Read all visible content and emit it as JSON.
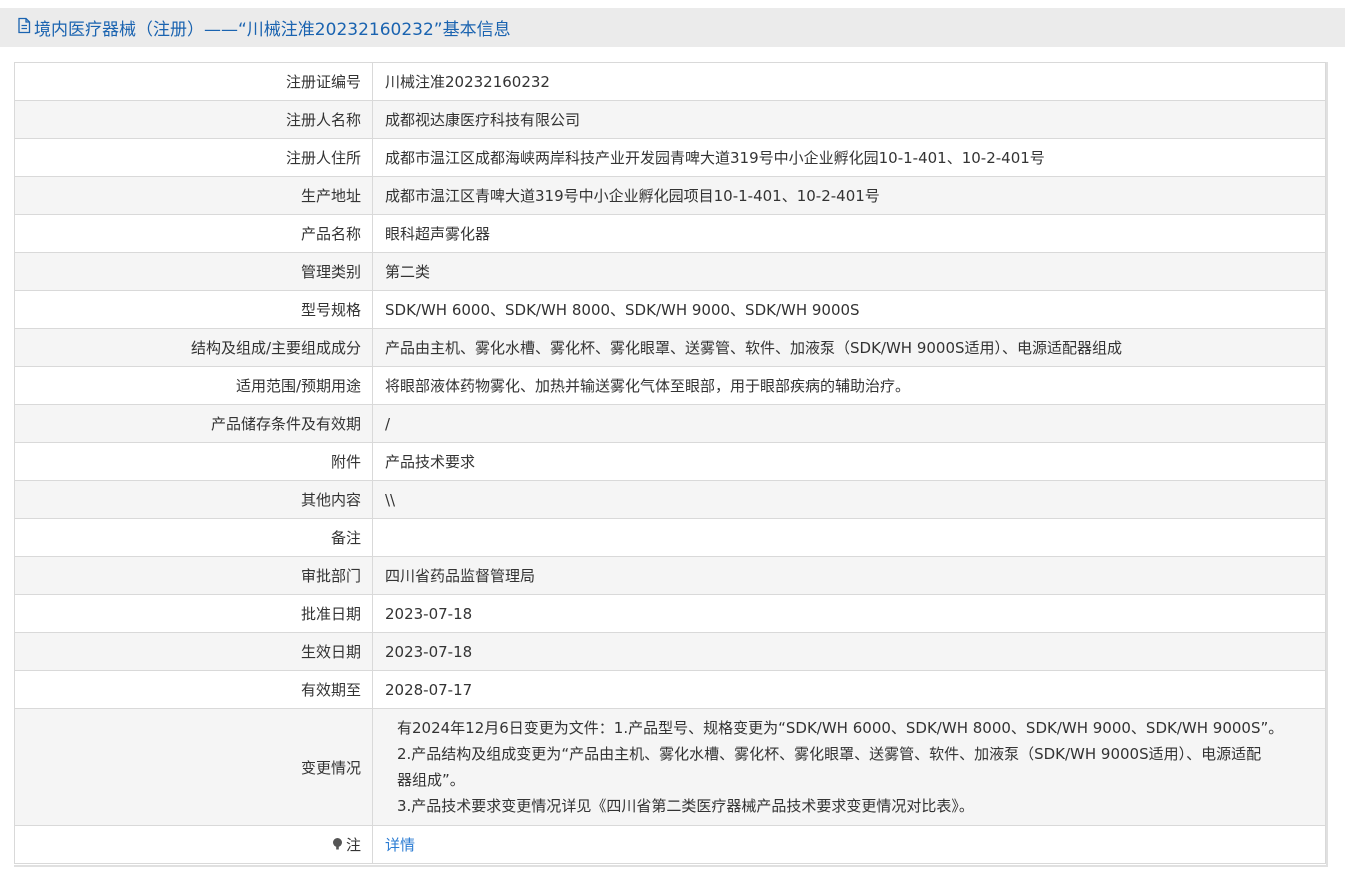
{
  "header": {
    "title": "境内医疗器械（注册）——“川械注准20232160232”基本信息",
    "icon": "document-icon",
    "color": "#1a63b0"
  },
  "rows": [
    {
      "label": "注册证编号",
      "value": "川械注准20232160232"
    },
    {
      "label": "注册人名称",
      "value": "成都视达康医疗科技有限公司"
    },
    {
      "label": "注册人住所",
      "value": "成都市温江区成都海峡两岸科技产业开发园青啤大道319号中小企业孵化园10-1-401、10-2-401号"
    },
    {
      "label": "生产地址",
      "value": "成都市温江区青啤大道319号中小企业孵化园项目10-1-401、10-2-401号"
    },
    {
      "label": "产品名称",
      "value": "眼科超声雾化器"
    },
    {
      "label": "管理类别",
      "value": "第二类"
    },
    {
      "label": "型号规格",
      "value": "SDK/WH 6000、SDK/WH 8000、SDK/WH 9000、SDK/WH 9000S"
    },
    {
      "label": "结构及组成/主要组成成分",
      "value": "产品由主机、雾化水槽、雾化杯、雾化眼罩、送雾管、软件、加液泵（SDK/WH 9000S适用）、电源适配器组成"
    },
    {
      "label": "适用范围/预期用途",
      "value": "将眼部液体药物雾化、加热并输送雾化气体至眼部，用于眼部疾病的辅助治疗。"
    },
    {
      "label": "产品储存条件及有效期",
      "value": "/"
    },
    {
      "label": "附件",
      "value": "产品技术要求"
    },
    {
      "label": "其他内容",
      "value": "\\\\"
    },
    {
      "label": "备注",
      "value": ""
    },
    {
      "label": "审批部门",
      "value": "四川省药品监督管理局"
    },
    {
      "label": "批准日期",
      "value": "2023-07-18"
    },
    {
      "label": "生效日期",
      "value": "2023-07-18"
    },
    {
      "label": "有效期至",
      "value": "2028-07-17"
    }
  ],
  "change": {
    "label": "变更情况",
    "lines": [
      "有2024年12月6日变更为文件：1.产品型号、规格变更为“SDK/WH 6000、SDK/WH 8000、SDK/WH 9000、SDK/WH 9000S”。",
      "2.产品结构及组成变更为“产品由主机、雾化水槽、雾化杯、雾化眼罩、送雾管、软件、加液泵（SDK/WH 9000S适用）、电源适配",
      "器组成”。",
      "3.产品技术要求变更情况详见《四川省第二类医疗器械产品技术要求变更情况对比表》。"
    ]
  },
  "note": {
    "label": "注",
    "icon": "note-icon",
    "link_text": "详情",
    "link_color": "#2b7cd3"
  }
}
